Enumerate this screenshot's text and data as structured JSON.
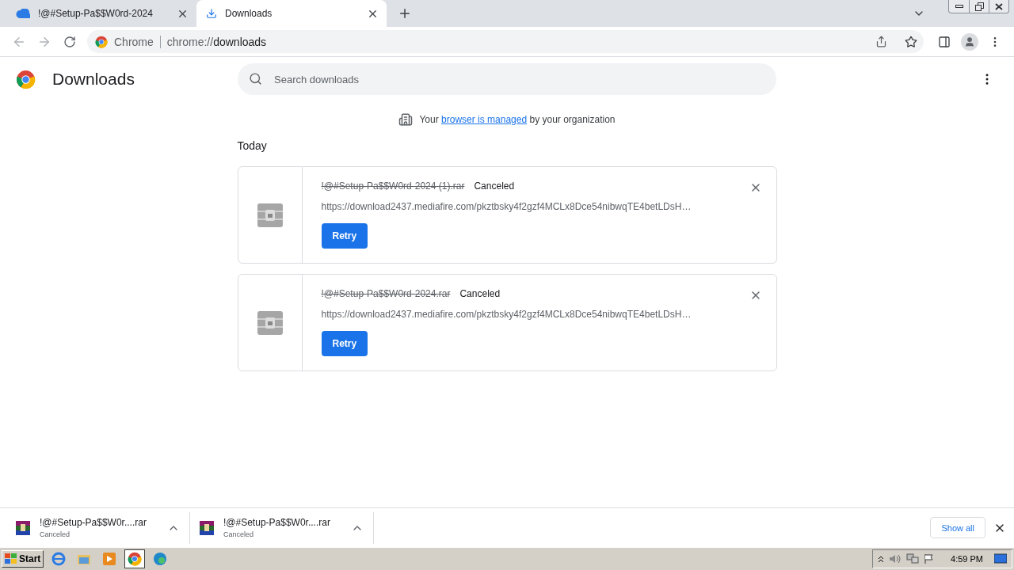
{
  "tabs": [
    {
      "title": "!@#Setup-Pa$$W0rd-2024",
      "kind": "site",
      "selected": false
    },
    {
      "title": "Downloads",
      "kind": "downloads",
      "selected": true
    }
  ],
  "toolbar": {
    "site_label": "Chrome",
    "url_prefix": "chrome://",
    "url_path": "downloads"
  },
  "page": {
    "title": "Downloads",
    "search": {
      "placeholder": "Search downloads"
    },
    "managed_notice": {
      "before": "Your",
      "link": "browser is managed",
      "after": "by your organization"
    },
    "section": "Today",
    "downloads": [
      {
        "file_name": "!@#Setup-Pa$$W0rd-2024 (1).rar",
        "status": "Canceled",
        "canceled": true,
        "url": "https://download2437.mediafire.com/pkztbsky4f2gzf4MCLx8Dce54nibwqTE4betLDsH…",
        "action": "Retry"
      },
      {
        "file_name": "!@#Setup-Pa$$W0rd-2024.rar",
        "status": "Canceled",
        "canceled": true,
        "url": "https://download2437.mediafire.com/pkztbsky4f2gzf4MCLx8Dce54nibwqTE4betLDsH…",
        "action": "Retry"
      }
    ]
  },
  "shelf": {
    "items": [
      {
        "name": "!@#Setup-Pa$$W0r....rar",
        "status": "Canceled"
      },
      {
        "name": "!@#Setup-Pa$$W0r....rar",
        "status": "Canceled"
      }
    ],
    "show_all": "Show all"
  },
  "taskbar": {
    "start": "Start",
    "clock": "4:59 PM"
  }
}
